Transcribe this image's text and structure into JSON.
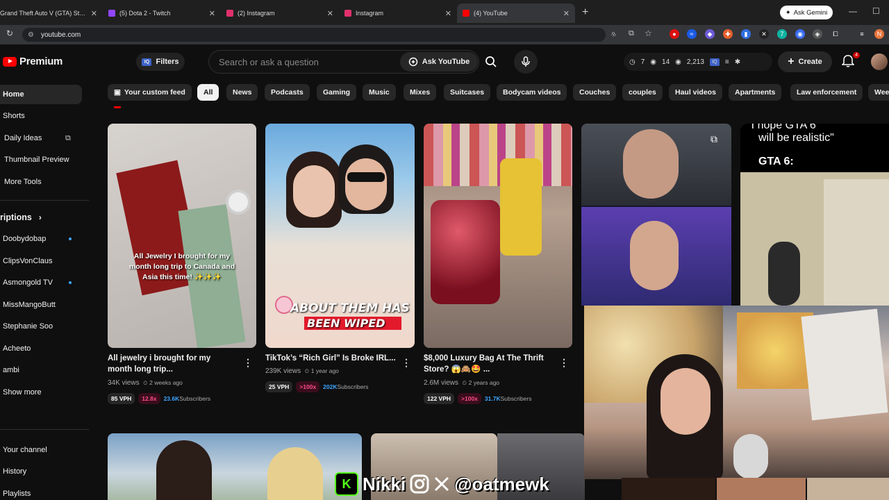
{
  "browser": {
    "tabs": [
      {
        "title": "Grand Theft Auto V (GTA) Strea",
        "fav_color": "#9146ff"
      },
      {
        "title": "(5) Dota 2 - Twitch",
        "fav_color": "#9146ff"
      },
      {
        "title": "(2) Instagram",
        "fav_color": "#e1306c"
      },
      {
        "title": "Instagram",
        "fav_color": "#e1306c"
      },
      {
        "title": "(4) YouTube",
        "fav_color": "#ff0000"
      }
    ],
    "ask_gemini": "Ask Gemini",
    "url": "youtube.com"
  },
  "header": {
    "brand": "Premium",
    "filters_label": "Filters",
    "iq_badge": "IQ",
    "search_placeholder": "Search or ask a question",
    "ask_label": "Ask YouTube",
    "stat1": "7",
    "stat2": "14",
    "stat3": "2,213",
    "create_label": "Create",
    "notif_count": "4"
  },
  "sidebar": {
    "main": [
      "Home",
      "Shorts",
      "Daily Ideas",
      "Thumbnail Preview",
      "More Tools"
    ],
    "subs_heading": "riptions",
    "subs": [
      {
        "name": "Doobydobap",
        "live": true
      },
      {
        "name": "ClipsVonClaus",
        "live": false
      },
      {
        "name": "Asmongold TV",
        "live": true
      },
      {
        "name": "MissMangoButt",
        "live": false
      },
      {
        "name": "Stephanie Soo",
        "live": false
      },
      {
        "name": "Acheeto",
        "live": false
      },
      {
        "name": "ambi",
        "live": false
      }
    ],
    "show_more": "Show more",
    "you": [
      "Your channel",
      "History",
      "Playlists"
    ]
  },
  "chips": [
    "Your custom feed",
    "All",
    "News",
    "Podcasts",
    "Gaming",
    "Music",
    "Mixes",
    "Suitcases",
    "Bodycam videos",
    "Couches",
    "couples",
    "Haul videos",
    "Apartments",
    "Law enforcement",
    "Wee"
  ],
  "videos": [
    {
      "title1": "All jewelry i brought for my",
      "title2": "month long trip...",
      "views": "34K views",
      "age": "2 weeks ago",
      "vph": "85 VPH",
      "ratio": "12.8x",
      "subs_num": "23.6K",
      "subs_word": "Subscribers",
      "thumb_text": "All Jewelry I brought for my month long trip to Canada and Asia this time! ✨✨✨"
    },
    {
      "title1": "TikTok’s “Rich Girl” Is Broke IRL...",
      "views": "239K views",
      "age": "1 year ago",
      "vph": "25 VPH",
      "ratio": ">100x",
      "subs_num": "202K",
      "subs_word": "Subscribers",
      "thumb_text1": "ABOUT THEM HAS",
      "thumb_text2": "BEEN WIPED"
    },
    {
      "title1": "$8,000 Luxury Bag At The Thrift",
      "title2": "Store? 😱🙈🤩 ...",
      "views": "2.6M views",
      "age": "2 years ago",
      "vph": "122 VPH",
      "ratio": ">100x",
      "subs_num": "31.7K",
      "subs_word": "Subscribers"
    },
    {
      "thumb_text1": "\"I hope GTA 6",
      "thumb_text2": "will be realistic\"",
      "thumb_text3": "GTA 6:"
    }
  ],
  "overlay": {
    "handle": "Nikki",
    "social": "@oatmewk",
    "kick_letter": "K"
  }
}
